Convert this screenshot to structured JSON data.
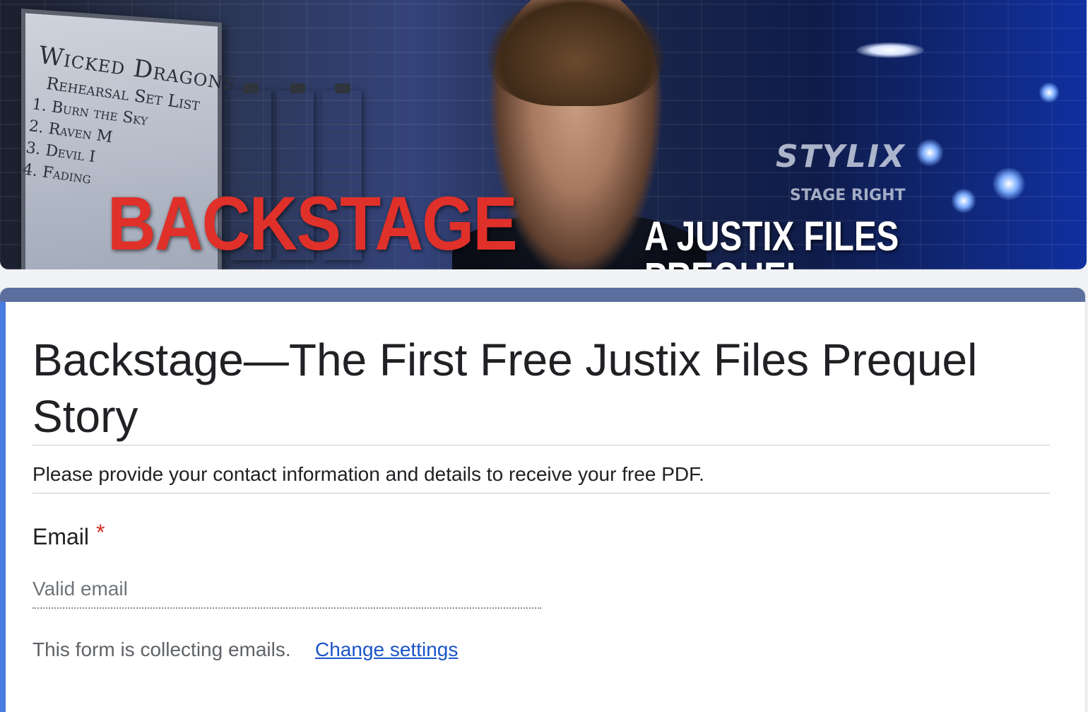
{
  "banner": {
    "whiteboard_title": "Wicked Dragons",
    "whiteboard_subtitle": "Rehearsal Set List",
    "setlist": [
      "1. Burn the Sky",
      "2. Raven M",
      "3. Devil I",
      "4. Fading"
    ],
    "sign_brand": "STYLIX",
    "sign_text": "STAGE RIGHT",
    "headline": "BACKSTAGE",
    "tagline": "A JUSTIX FILES PREQUEL"
  },
  "form": {
    "title": "Backstage—The First Free Justix Files Prequel Story",
    "description": "Please provide your contact information and details to receive your free PDF.",
    "email_question": {
      "label": "Email",
      "required_marker": "*",
      "placeholder": "Valid email",
      "value": ""
    },
    "collecting_note": "This form is collecting emails.",
    "change_settings_link": "Change settings"
  },
  "colors": {
    "header_bar": "#5b6e9e",
    "left_accent": "#4a7de0",
    "required": "#d93025",
    "link": "#1a55c8",
    "headline_red": "#e0302a"
  }
}
